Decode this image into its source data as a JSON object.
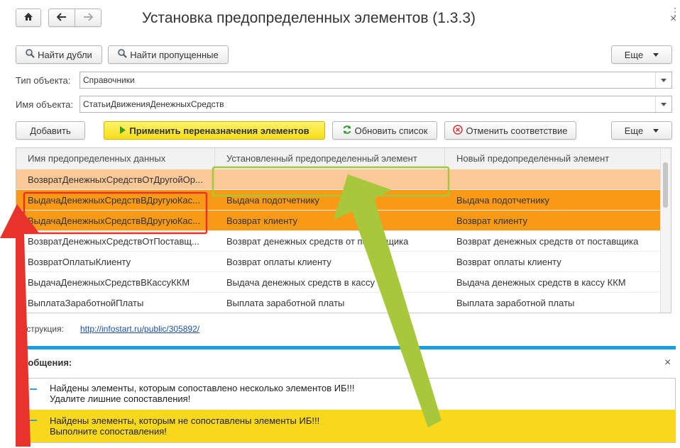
{
  "window": {
    "title": "Установка предопределенных элементов (1.3.3)"
  },
  "toolbar_top": {
    "find_duplicates": "Найти дубли",
    "find_missing": "Найти пропущенные",
    "more": "Еще"
  },
  "fields": {
    "object_type_label": "Тип объекта:",
    "object_type_value": "Справочники",
    "object_name_label": "Имя объекта:",
    "object_name_value": "СтатьиДвиженияДенежныхСредств"
  },
  "toolbar_grid": {
    "add": "Добавить",
    "apply": "Применить переназначения элементов",
    "refresh": "Обновить список",
    "cancel_match": "Отменить соответствие",
    "more": "Еще"
  },
  "table": {
    "columns": [
      "Имя предопределенных данных",
      "Установленный предопределенный элемент",
      "Новый предопределенный элемент"
    ],
    "rows": [
      {
        "name": "ВозвратДенежныхСредствОтДругойОр...",
        "installed": "",
        "new": ""
      },
      {
        "name": "ВыдачаДенежныхСредствВДругуюКас...",
        "installed": "Выдача подотчетнику",
        "new": "Выдача подотчетнику"
      },
      {
        "name": "ВыдачаДенежныхСредствВДругуюКас...",
        "installed": "Возврат клиенту",
        "new": "Возврат клиенту"
      },
      {
        "name": "ВозвратДенежныхСредствОтПоставщ...",
        "installed": "Возврат денежных средств от поставщика",
        "new": "Возврат денежных средств от поставщика"
      },
      {
        "name": "ВозвратОплатыКлиенту",
        "installed": "Возврат оплаты клиенту",
        "new": "Возврат оплаты клиенту"
      },
      {
        "name": "ВыдачаДенежныхСредствВКассуККМ",
        "installed": "Выдача денежных средств в кассу ККМ",
        "new": "Выдача денежных средств в кассу ККМ"
      },
      {
        "name": "ВыплатаЗаработнойПлаты",
        "installed": "Выплата заработной платы",
        "new": "Выплата заработной платы"
      }
    ]
  },
  "instruction": {
    "label": "Инструкция:",
    "link": "http://infostart.ru/public/305892/"
  },
  "messages": {
    "title": "Сообщения:",
    "items": [
      {
        "line1": "Найдены элементы, которым сопоставлено несколько элементов ИБ!!!",
        "line2": "Удалите лишние сопоставления!"
      },
      {
        "line1": "Найдены элементы, которым не сопоставлены элементы ИБ!!!",
        "line2": "Выполните сопоставления!"
      }
    ]
  },
  "colors": {
    "row_light_orange": "#fbc898",
    "row_orange": "#f99a16",
    "message_yellow": "#f7d81d",
    "divider_blue": "#1a9fdb",
    "arrow_red": "#e8332d",
    "arrow_green": "#a6c83a"
  }
}
